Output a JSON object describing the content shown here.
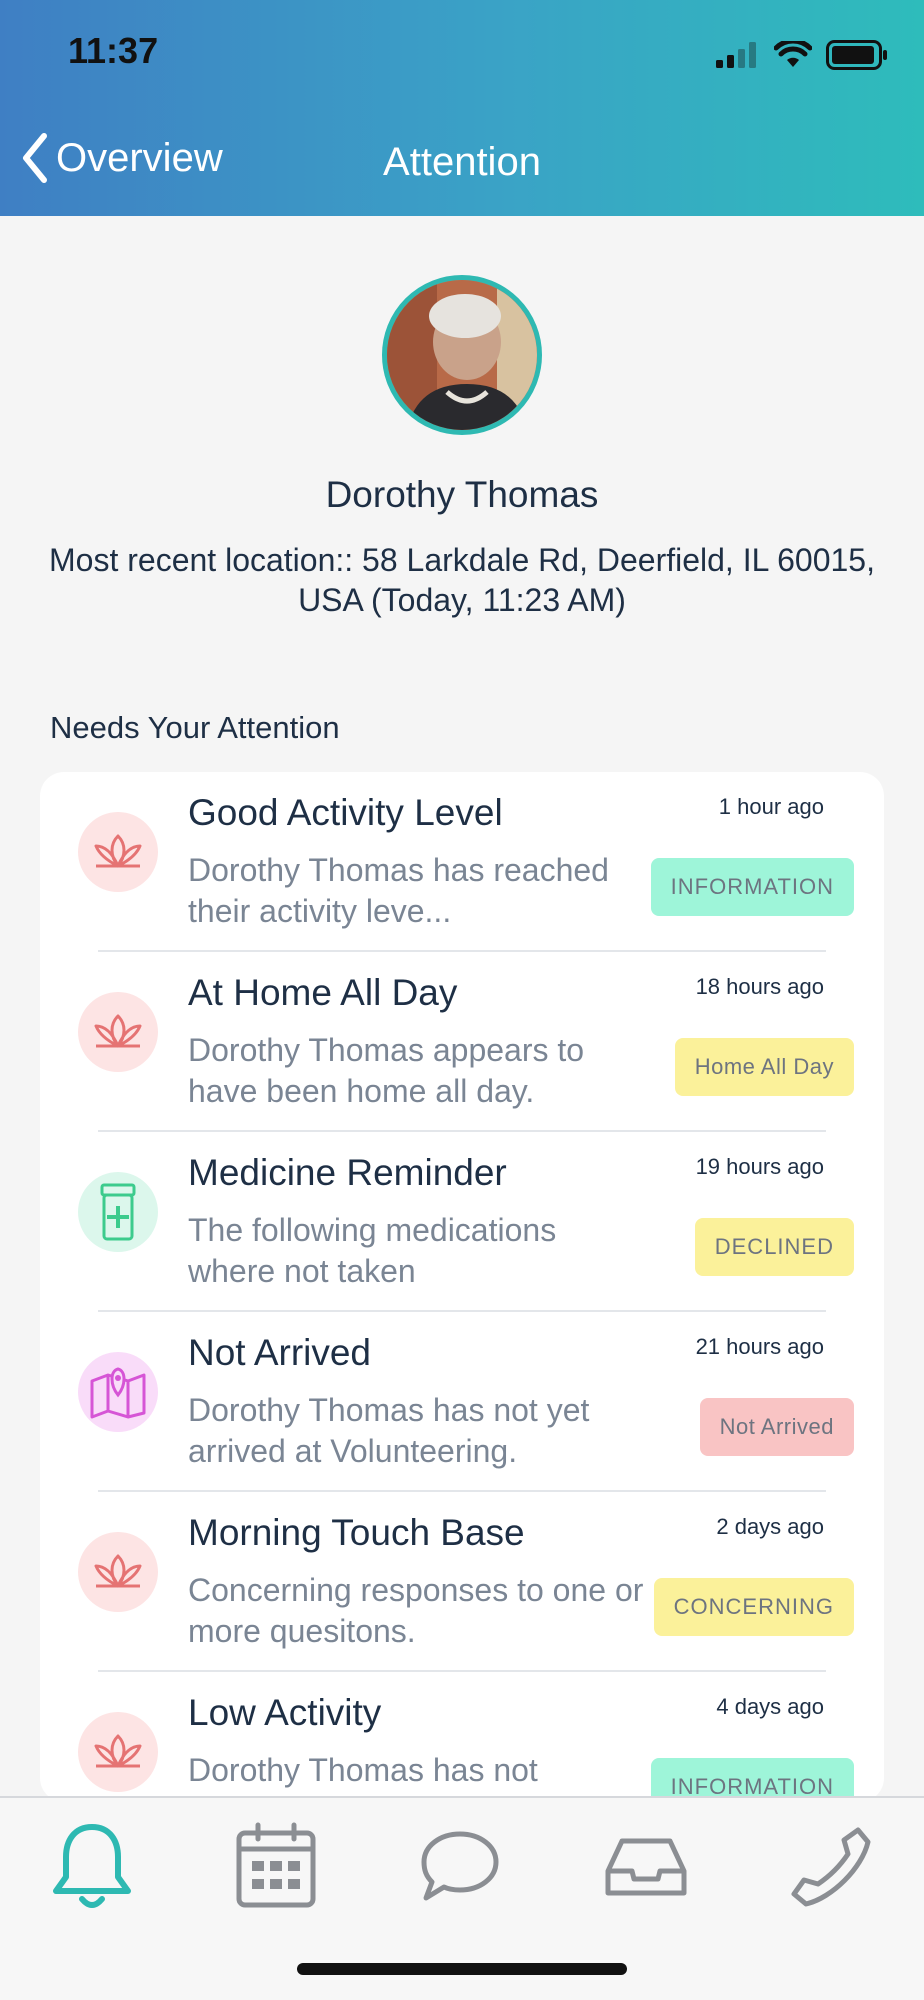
{
  "status_bar": {
    "time": "11:37"
  },
  "nav": {
    "back_label": "Overview",
    "title": "Attention"
  },
  "profile": {
    "name": "Dorothy Thomas",
    "location": "Most recent location:: 58 Larkdale Rd, Deerfield, IL 60015, USA (Today, 11:23 AM)"
  },
  "section": {
    "title": "Needs Your Attention"
  },
  "alerts": [
    {
      "title": "Good Activity Level",
      "description": "Dorothy Thomas has reached their activity leve...",
      "time": "1 hour ago",
      "badge": "INFORMATION",
      "icon": "lotus-icon"
    },
    {
      "title": "At Home All Day",
      "description": "Dorothy Thomas appears to have been home all day.",
      "time": "18 hours ago",
      "badge": "Home All Day",
      "icon": "lotus-icon"
    },
    {
      "title": "Medicine Reminder",
      "description": "The following medications where not taken",
      "time": "19 hours ago",
      "badge": "DECLINED",
      "icon": "pill-bottle-icon"
    },
    {
      "title": "Not Arrived",
      "description": "Dorothy Thomas has not yet arrived at Volunteering.",
      "time": "21 hours ago",
      "badge": "Not Arrived",
      "icon": "map-pin-icon"
    },
    {
      "title": "Morning Touch Base",
      "description": "Concerning responses to one or more quesitons.",
      "time": "2 days ago",
      "badge": "CONCERNING",
      "icon": "lotus-icon"
    },
    {
      "title": "Low Activity",
      "description": "Dorothy Thomas has not",
      "time": "4 days ago",
      "badge": "INFORMATION",
      "icon": "lotus-icon"
    }
  ],
  "colors": {
    "accent": "#2eb9b2",
    "badge_information": "#9ef5d9",
    "badge_yellow": "#fbf19a",
    "badge_red": "#f9c4c4",
    "icon_bg_red": "#fde4e4",
    "icon_bg_green": "#dcf7ec",
    "icon_bg_pink": "#f9dcf9"
  },
  "tabs": [
    {
      "icon": "bell-icon",
      "active": true
    },
    {
      "icon": "calendar-icon",
      "active": false
    },
    {
      "icon": "chat-bubble-icon",
      "active": false
    },
    {
      "icon": "inbox-icon",
      "active": false
    },
    {
      "icon": "phone-icon",
      "active": false
    }
  ]
}
